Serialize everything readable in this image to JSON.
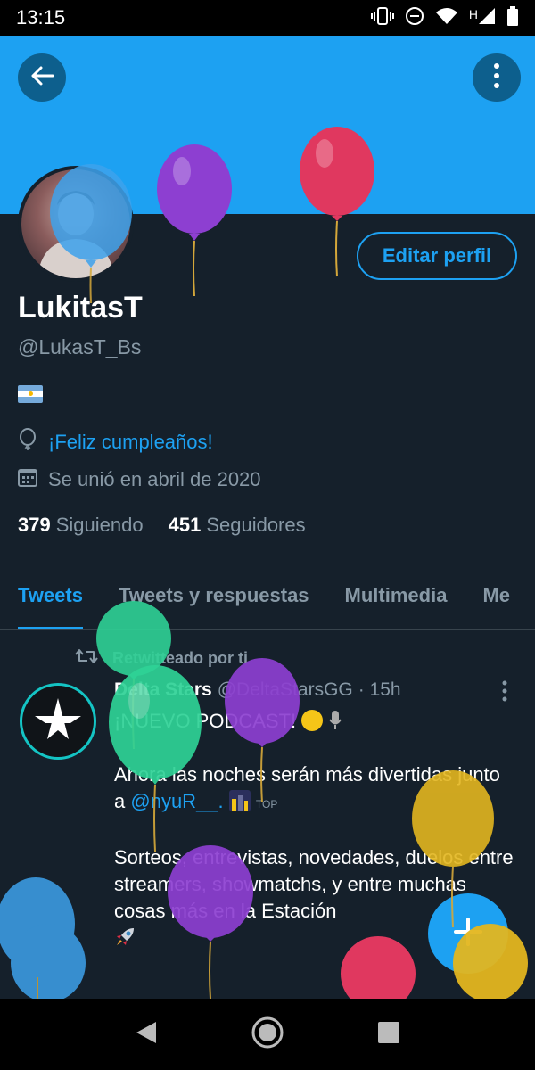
{
  "status_bar": {
    "time": "13:15",
    "network_label": "H",
    "icons": [
      "vibrate-icon",
      "do-not-disturb-icon",
      "wifi-icon",
      "signal-icon",
      "battery-icon"
    ]
  },
  "header": {
    "back_icon": "arrow-left-icon",
    "more_icon": "more-vertical-icon"
  },
  "profile": {
    "display_name": "LukitasT",
    "handle": "@LukasT_Bs",
    "flag": "argentina-flag",
    "birthday_text": "¡Feliz cumpleaños!",
    "joined_text": "Se unió en abril de 2020",
    "following_count": "379",
    "following_label": "Siguiendo",
    "followers_count": "451",
    "followers_label": "Seguidores",
    "edit_button": "Editar perfil"
  },
  "tabs": [
    {
      "label": "Tweets",
      "active": true
    },
    {
      "label": "Tweets y respuestas",
      "active": false
    },
    {
      "label": "Multimedia",
      "active": false
    },
    {
      "label": "Me",
      "active": false
    }
  ],
  "tweet": {
    "retweet_label": "Retwitteado por ti",
    "author_name": "Delta Stars",
    "author_handle": "@DeltaStarsGG",
    "time": "· 15h",
    "line1": "¡NUEVO PODCAST!",
    "line2_prefix": "Ahora las noches serán más divertidas junto a",
    "mention": "@nyuR__.",
    "top_badge": "TOP",
    "paragraph3": "Sorteos, entrevistas, novedades, duelos entre streamers, showmatchs, y entre muchas cosas más en la Estación"
  },
  "colors": {
    "background": "#15202b",
    "accent": "#1da1f2",
    "secondary_text": "#8899a6",
    "divider": "#38444d"
  }
}
